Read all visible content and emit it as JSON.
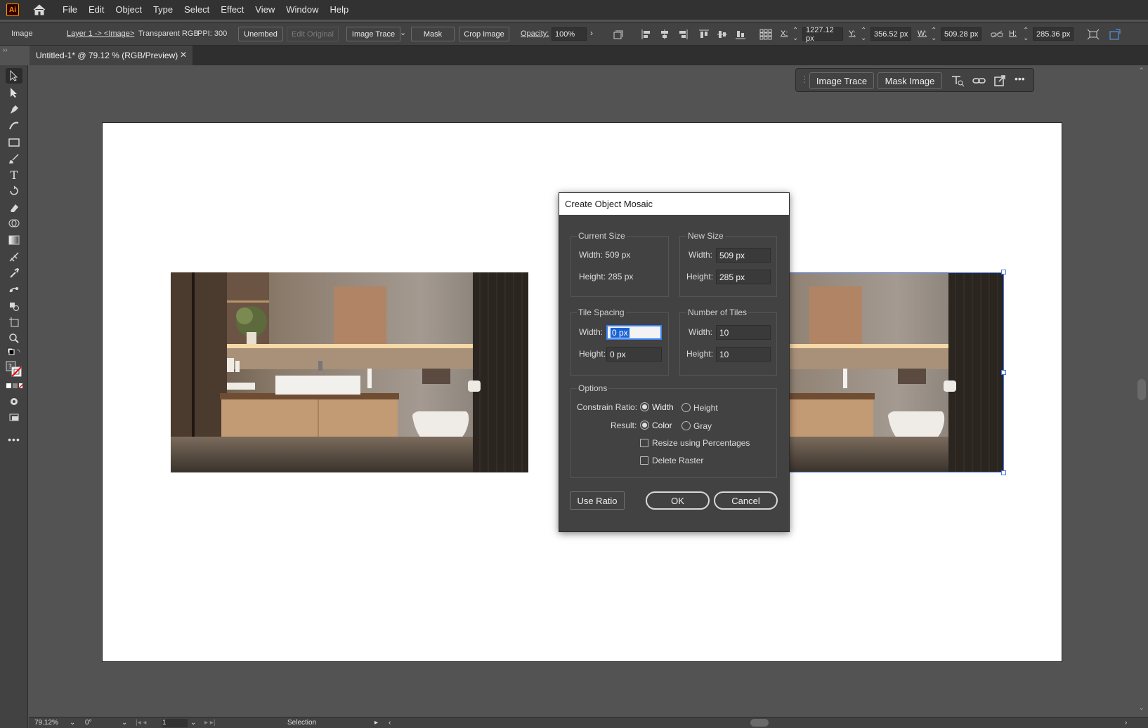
{
  "app": {
    "logo": "Ai",
    "menus": [
      "File",
      "Edit",
      "Object",
      "Type",
      "Select",
      "Effect",
      "View",
      "Window",
      "Help"
    ]
  },
  "control_bar": {
    "object_type": "Image",
    "layer_path": "Layer 1 -> <Image>",
    "color_mode": "Transparent RGB",
    "ppi": "PPI: 300",
    "unembed_label": "Unembed",
    "edit_original_label": "Edit Original",
    "image_trace_label": "Image Trace",
    "mask_label": "Mask",
    "crop_image_label": "Crop Image",
    "opacity_label": "Opacity:",
    "opacity_value": "100%",
    "x_label": "X:",
    "x_value": "1227.12 px",
    "y_label": "Y:",
    "y_value": "356.52 px",
    "w_label": "W:",
    "w_value": "509.28 px",
    "h_label": "H:",
    "h_value": "285.36 px"
  },
  "document": {
    "tab_title": "Untitled-1* @ 79.12 % (RGB/Preview)",
    "close_glyph": "✕"
  },
  "contextual_taskbar": {
    "image_trace_label": "Image Trace",
    "mask_image_label": "Mask Image"
  },
  "dialog": {
    "title": "Create Object Mosaic",
    "current_size": {
      "heading": "Current Size",
      "width_text": "Width: 509 px",
      "height_text": "Height: 285 px"
    },
    "new_size": {
      "heading": "New Size",
      "width_label": "Width:",
      "width_value": "509 px",
      "height_label": "Height:",
      "height_value": "285 px"
    },
    "tile_spacing": {
      "heading": "Tile Spacing",
      "width_label": "Width:",
      "width_value": "0 px",
      "height_label": "Height:",
      "height_value": "0 px"
    },
    "number_of_tiles": {
      "heading": "Number of Tiles",
      "width_label": "Width:",
      "width_value": "10",
      "height_label": "Height:",
      "height_value": "10"
    },
    "options": {
      "heading": "Options",
      "constrain_label": "Constrain Ratio:",
      "constrain_width": "Width",
      "constrain_height": "Height",
      "constrain_selected": "Width",
      "result_label": "Result:",
      "result_color": "Color",
      "result_gray": "Gray",
      "result_selected": "Color",
      "resize_percent_label": "Resize using Percentages",
      "resize_percent_checked": false,
      "delete_raster_label": "Delete Raster",
      "delete_raster_checked": false
    },
    "use_ratio_label": "Use Ratio",
    "ok_label": "OK",
    "cancel_label": "Cancel"
  },
  "status_bar": {
    "zoom": "79.12%",
    "rotation": "0°",
    "artboard_number": "1",
    "tool_name": "Selection"
  },
  "colors": {
    "accent": "#3b82f6",
    "selection_bounds": "#4a78e0",
    "panel_bg": "#424242",
    "canvas_bg": "#535353"
  }
}
